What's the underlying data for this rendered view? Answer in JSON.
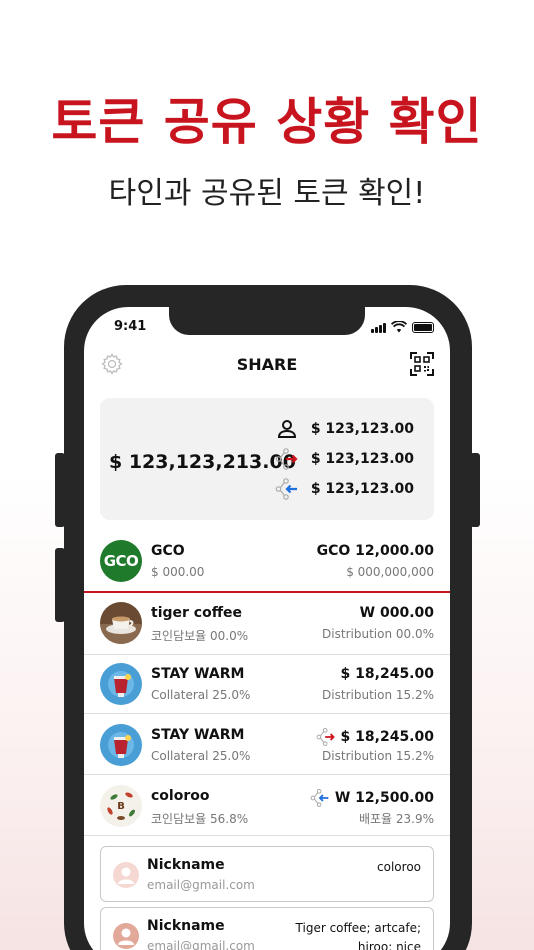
{
  "promo": {
    "headline": "토큰 공유 상황 확인",
    "subheadline": "타인과 공유된 토큰 확인!"
  },
  "status_bar": {
    "time": "9:41"
  },
  "header": {
    "title": "SHARE",
    "left_icon": "gear-icon",
    "right_icon": "qr-scan-icon"
  },
  "summary": {
    "total": "$ 123,123,213.00",
    "rows": [
      {
        "icon": "person-icon",
        "value": "$ 123,123.00"
      },
      {
        "icon": "share-out-icon",
        "value": "$ 123,123.00"
      },
      {
        "icon": "share-in-icon",
        "value": "$ 123,123.00"
      }
    ]
  },
  "gco": {
    "logo": "GCO",
    "name": "GCO",
    "sub": "$ 000.00",
    "amount": "GCO 12,000.00",
    "sub_right": "$ 000,000,000"
  },
  "tokens": [
    {
      "name": "tiger coffee",
      "sub": "코인담보율 00.0%",
      "amount": "W 000.00",
      "sub_right": "Distribution 00.0%",
      "share_icon": ""
    },
    {
      "name": "STAY WARM",
      "sub": "Collateral 25.0%",
      "amount": "$ 18,245.00",
      "sub_right": "Distribution 15.2%",
      "share_icon": ""
    },
    {
      "name": "STAY WARM",
      "sub": "Collateral 25.0%",
      "amount": "$ 18,245.00",
      "sub_right": "Distribution 15.2%",
      "share_icon": "share-out-icon"
    },
    {
      "name": "coloroo",
      "sub": "코인담보율 56.8%",
      "amount": "W 12,500.00",
      "sub_right": "배포율 23.9%",
      "share_icon": "share-in-icon"
    }
  ],
  "shared_with": [
    {
      "nickname": "Nickname",
      "email": "email@gmail.com",
      "tag": "coloroo"
    },
    {
      "nickname": "Nickname",
      "email": "email@gmail.com",
      "tag_line1": "Tiger coffee; artcafe;",
      "tag_line2": "hiroo; nice"
    }
  ],
  "colors": {
    "accent_red": "#c8141e",
    "share_out_arrow": "#d0141e",
    "share_in_arrow": "#1e6fe0",
    "gco_green": "#1f7a2b",
    "phone_frame": "#262626"
  }
}
